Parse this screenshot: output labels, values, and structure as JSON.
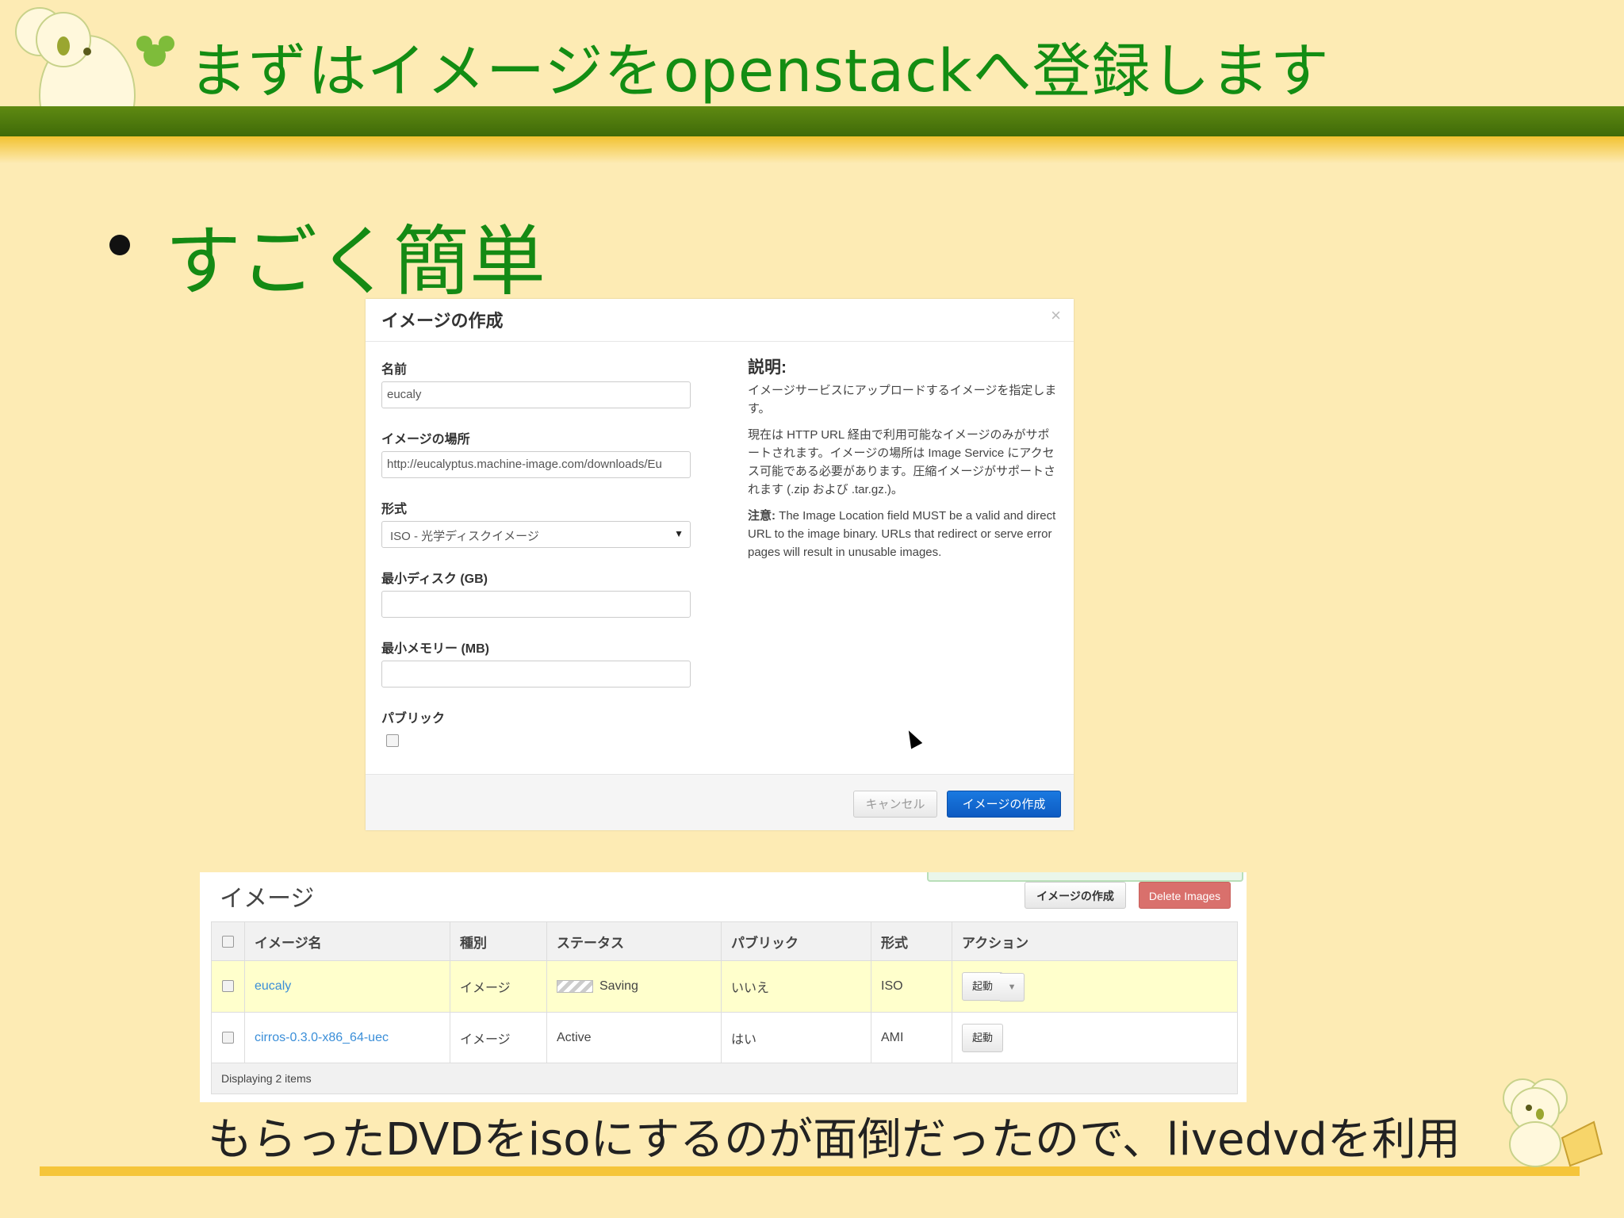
{
  "slide": {
    "title": "まずはイメージをopenstackへ登録します",
    "bullet": "すごく簡単",
    "footer_note": "もらったDVDをisoにするのが面倒だったので、livedvdを利用"
  },
  "dialog": {
    "title": "イメージの作成",
    "close": "×",
    "name_label": "名前",
    "name_value": "eucaly",
    "location_label": "イメージの場所",
    "location_value": "http://eucalyptus.machine-image.com/downloads/Eu",
    "format_label": "形式",
    "format_value": "ISO - 光学ディスクイメージ",
    "min_disk_label": "最小ディスク (GB)",
    "min_disk_value": "",
    "min_mem_label": "最小メモリー (MB)",
    "min_mem_value": "",
    "public_label": "パブリック",
    "help_title": "説明:",
    "help_p1": "イメージサービスにアップロードするイメージを指定します。",
    "help_p2": "現在は HTTP URL 経由で利用可能なイメージのみがサポートされます。イメージの場所は Image Service にアクセス可能である必要があります。圧縮イメージがサポートされます (.zip および .tar.gz.)。",
    "help_note_label": "注意:",
    "help_note": "The Image Location field MUST be a valid and direct URL to the image binary. URLs that redirect or serve error pages will result in unusable images.",
    "cancel_label": "キャンセル",
    "create_label": "イメージの作成"
  },
  "images_panel": {
    "title": "イメージ",
    "create_button": "イメージの作成",
    "delete_button": "Delete Images",
    "columns": [
      "イメージ名",
      "種別",
      "ステータス",
      "パブリック",
      "形式",
      "アクション"
    ],
    "rows": [
      {
        "name": "eucaly",
        "type": "イメージ",
        "status": "Saving",
        "public": "いいえ",
        "format": "ISO",
        "action": "起動"
      },
      {
        "name": "cirros-0.3.0-x86_64-uec",
        "type": "イメージ",
        "status": "Active",
        "public": "はい",
        "format": "AMI",
        "action": "起動"
      }
    ],
    "footer": "Displaying 2 items"
  },
  "colors": {
    "title_green": "#138d13",
    "band_green": "#4f7a0d",
    "slide_bg": "#fdebb4",
    "primary_blue": "#0d5bc2",
    "danger_red": "#d9706c"
  }
}
